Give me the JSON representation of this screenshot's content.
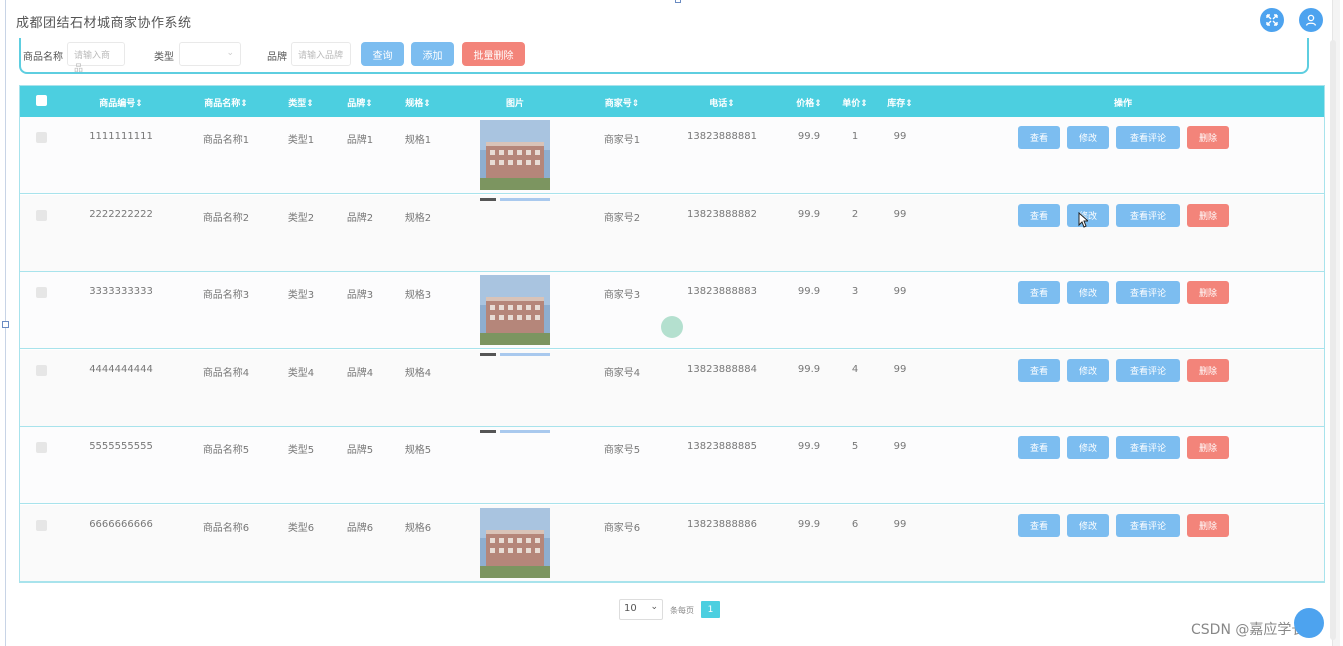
{
  "app": {
    "title": "成都团结石材城商家协作系统"
  },
  "header": {
    "icons": [
      "expand-icon",
      "user-icon"
    ]
  },
  "search": {
    "name_label": "商品名称",
    "name_placeholder": "请输入商品",
    "type_label": "类型",
    "brand_label": "品牌",
    "brand_placeholder": "请输入品牌",
    "query_button": "查询",
    "add_button": "添加",
    "batch_delete_button": "批量删除"
  },
  "table": {
    "headers": {
      "code": "商品编号⇕",
      "name": "商品名称⇕",
      "type": "类型⇕",
      "brand": "品牌⇕",
      "spec": "规格⇕",
      "image": "图片",
      "merchant": "商家号⇕",
      "phone": "电话⇕",
      "price": "价格⇕",
      "unit": "单价⇕",
      "stock": "库存⇕",
      "actions": "操作"
    },
    "rows": [
      {
        "code": "1111111111",
        "name": "商品名称1",
        "type": "类型1",
        "brand": "品牌1",
        "spec": "规格1",
        "merchant": "商家号1",
        "phone": "13823888881",
        "price": "99.9",
        "unit": "1",
        "stock": "99",
        "image": "photo"
      },
      {
        "code": "2222222222",
        "name": "商品名称2",
        "type": "类型2",
        "brand": "品牌2",
        "spec": "规格2",
        "merchant": "商家号2",
        "phone": "13823888882",
        "price": "99.9",
        "unit": "2",
        "stock": "99",
        "image": "broken"
      },
      {
        "code": "3333333333",
        "name": "商品名称3",
        "type": "类型3",
        "brand": "品牌3",
        "spec": "规格3",
        "merchant": "商家号3",
        "phone": "13823888883",
        "price": "99.9",
        "unit": "3",
        "stock": "99",
        "image": "photo"
      },
      {
        "code": "4444444444",
        "name": "商品名称4",
        "type": "类型4",
        "brand": "品牌4",
        "spec": "规格4",
        "merchant": "商家号4",
        "phone": "13823888884",
        "price": "99.9",
        "unit": "4",
        "stock": "99",
        "image": "broken"
      },
      {
        "code": "5555555555",
        "name": "商品名称5",
        "type": "类型5",
        "brand": "品牌5",
        "spec": "规格5",
        "merchant": "商家号5",
        "phone": "13823888885",
        "price": "99.9",
        "unit": "5",
        "stock": "99",
        "image": "broken"
      },
      {
        "code": "6666666666",
        "name": "商品名称6",
        "type": "类型6",
        "brand": "品牌6",
        "spec": "规格6",
        "merchant": "商家号6",
        "phone": "13823888886",
        "price": "99.9",
        "unit": "6",
        "stock": "99",
        "image": "photo"
      }
    ],
    "actions": {
      "view": "查看",
      "edit": "修改",
      "reviews": "查看评论",
      "delete": "删除"
    }
  },
  "pagination": {
    "page_size": "10",
    "label": "条每页",
    "current_page": "1"
  },
  "watermark": "CSDN @嘉应学长",
  "colors": {
    "header_teal": "#4ccfe0",
    "button_blue": "#7cbdf0",
    "button_red": "#f3847a",
    "icon_blue": "#4da3ef"
  }
}
